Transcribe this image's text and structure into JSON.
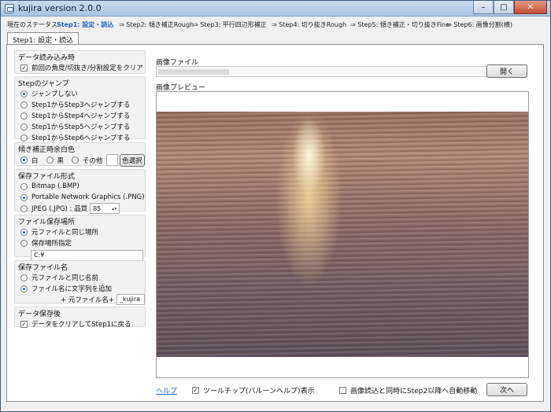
{
  "window": {
    "title": "kujira version 2.0.0"
  },
  "steps": {
    "status_label": "現在のステータス",
    "items": [
      "Step1: 設定・読込",
      "⇒ Step2: 傾き補正Rough",
      "⇒ Step3: 平行四辺形補正",
      "⇒ Step4: 切り抜きRough",
      "⇒ Step5: 傾き補正・切り抜きFine",
      "⇒ Step6: 画像分割(横)"
    ]
  },
  "tab": {
    "label": "Step1: 設定・読込"
  },
  "data_load": {
    "title": "データ読み込み時",
    "clear_label": "前回の角度/切抜き/分割設定をクリア",
    "checked": true
  },
  "jump": {
    "title": "Stepのジャンプ",
    "options": [
      "ジャンプしない",
      "Step1からStep3へジャンプする",
      "Step1からStep4へジャンプする",
      "Step1からStep5へジャンプする",
      "Step1からStep6へジャンプする"
    ],
    "selected": 0
  },
  "margin_color": {
    "title": "傾き補正時余白色",
    "white": "白",
    "black": "黒",
    "other": "その他",
    "select_button": "色選択"
  },
  "format": {
    "title": "保存ファイル形式",
    "bmp": "Bitmap (.BMP)",
    "png": "Portable Network Graphics (.PNG)",
    "jpeg": "JPEG (.JPG) : 品質",
    "quality": "85",
    "selected": "png"
  },
  "save_location": {
    "title": "ファイル保存場所",
    "same": "元ファイルと同じ場所",
    "specify": "保存場所指定",
    "path": "C:¥"
  },
  "save_name": {
    "title": "保存ファイル名",
    "same": "元ファイルと同じ名前",
    "add": "ファイル名に文字列を追加",
    "prefix": "+ 元ファイル名+",
    "suffix": "_kujira"
  },
  "after_save": {
    "title": "データ保存後",
    "clear_label": "データをクリアしてStep1に戻る",
    "checked": true
  },
  "image_file": {
    "label": "画像ファイル",
    "open_button": "開く"
  },
  "preview": {
    "label": "画像プレビュー"
  },
  "bottom": {
    "help_link": "ヘルプ",
    "tooltip_label": "ツールチップ(バルーンヘルプ)表示",
    "auto_move_label": "画像読込と同時にStep2以降へ自動移動",
    "next_button": "次へ"
  }
}
